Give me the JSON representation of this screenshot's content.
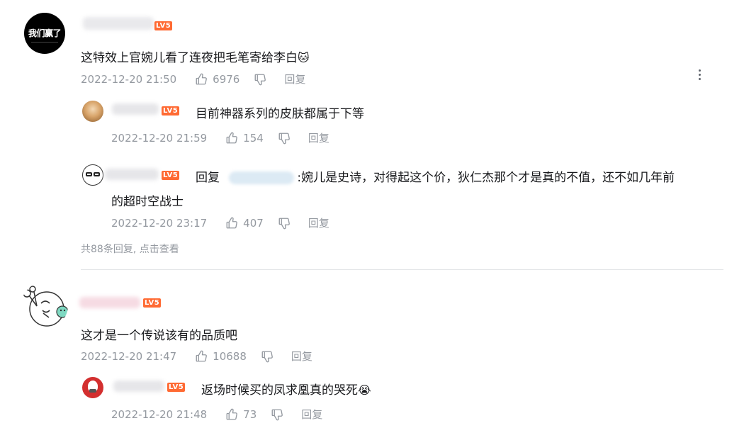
{
  "comments": [
    {
      "avatar_text": "我们赢了",
      "level": "LV5",
      "text": "这特效上官婉儿看了连夜把毛笔寄给李白",
      "emoji": "🐱",
      "time": "2022-12-20 21:50",
      "likes": "6976",
      "reply_label": "回复",
      "replies": [
        {
          "level": "LV5",
          "text": "目前神器系列的皮肤都属于下等",
          "time": "2022-12-20 21:59",
          "likes": "154",
          "reply_label": "回复"
        },
        {
          "level": "LV5",
          "reply_prefix": "回复",
          "text_line1": ":婉儿是史诗，对得起这个价，狄仁杰那个才是真的不值，还不如几年前",
          "text_line2": "的超时空战士",
          "time": "2022-12-20 23:17",
          "likes": "407",
          "reply_label": "回复"
        }
      ],
      "summary": "共88条回复, 点击查看"
    },
    {
      "level": "LV5",
      "text": "这才是一个传说该有的品质吧",
      "time": "2022-12-20 21:47",
      "likes": "10688",
      "reply_label": "回复",
      "replies": [
        {
          "level": "LV5",
          "text": "返场时候买的凤求凰真的哭死",
          "emoji": "😭",
          "time": "2022-12-20 21:48",
          "likes": "73",
          "reply_label": "回复"
        }
      ]
    }
  ],
  "icons": {
    "like": "thumb-up-icon",
    "dislike": "thumb-down-icon",
    "more": "more-vertical-icon"
  },
  "colors": {
    "level_badge": "#ff6a33",
    "meta_text": "#9499a0",
    "divider": "#e3e5e7"
  }
}
